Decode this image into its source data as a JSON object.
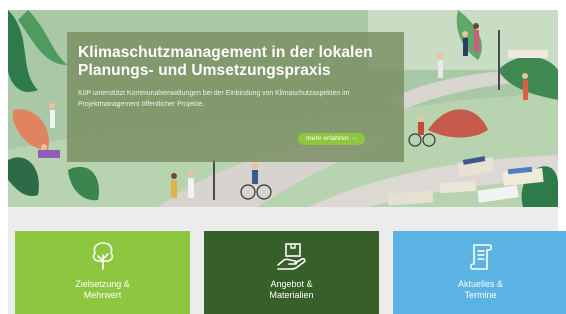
{
  "hero": {
    "title_line1": "Klimaschutzmanagement in der lokalen",
    "title_line2": "Planungs- und Umsetzungspraxis",
    "desc_line1": "KöP unterstützt Kommunalverwaltungen bei der Einbindung von Klimaschutzaspekten im",
    "desc_line2": "Projektmanagement öffentlicher Projekte.",
    "more_label": "mehr erfahren",
    "more_arrow": "→"
  },
  "tiles": [
    {
      "line1": "Zielsetzung &",
      "line2": "Mehrwert",
      "icon": "tree-icon",
      "color": "#8dc63f"
    },
    {
      "line1": "Angebot &",
      "line2": "Materialien",
      "icon": "box-hand-icon",
      "color": "#365f2a"
    },
    {
      "line1": "Aktuelles &",
      "line2": "Termine",
      "icon": "scroll-icon",
      "color": "#5ab3e3"
    }
  ],
  "colors": {
    "accent_green": "#8dc63f",
    "dark_green": "#365f2a",
    "sky_blue": "#5ab3e3"
  }
}
